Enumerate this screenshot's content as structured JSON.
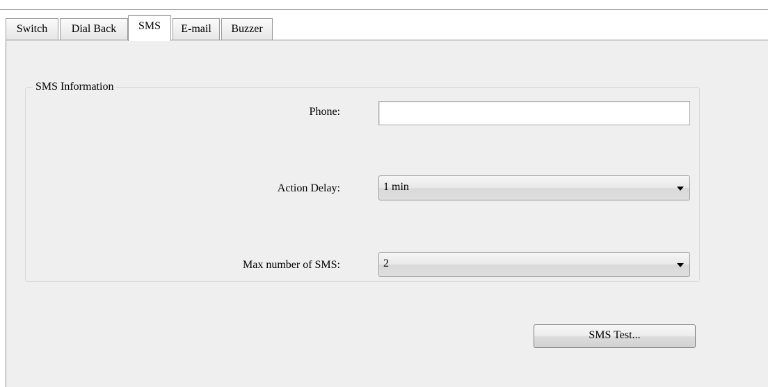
{
  "tabs": [
    {
      "label": "Switch"
    },
    {
      "label": "Dial Back"
    },
    {
      "label": "SMS"
    },
    {
      "label": "E-mail"
    },
    {
      "label": "Buzzer"
    }
  ],
  "active_tab": "SMS",
  "sms_info": {
    "legend": "SMS Information",
    "phone_label": "Phone:",
    "phone_value": "",
    "action_delay_label": "Action Delay:",
    "action_delay_value": "1 min",
    "max_sms_label": "Max number of SMS:",
    "max_sms_value": "2"
  },
  "test_button_label": "SMS Test...",
  "icons": {
    "dropdown": "chevron-down-icon"
  }
}
